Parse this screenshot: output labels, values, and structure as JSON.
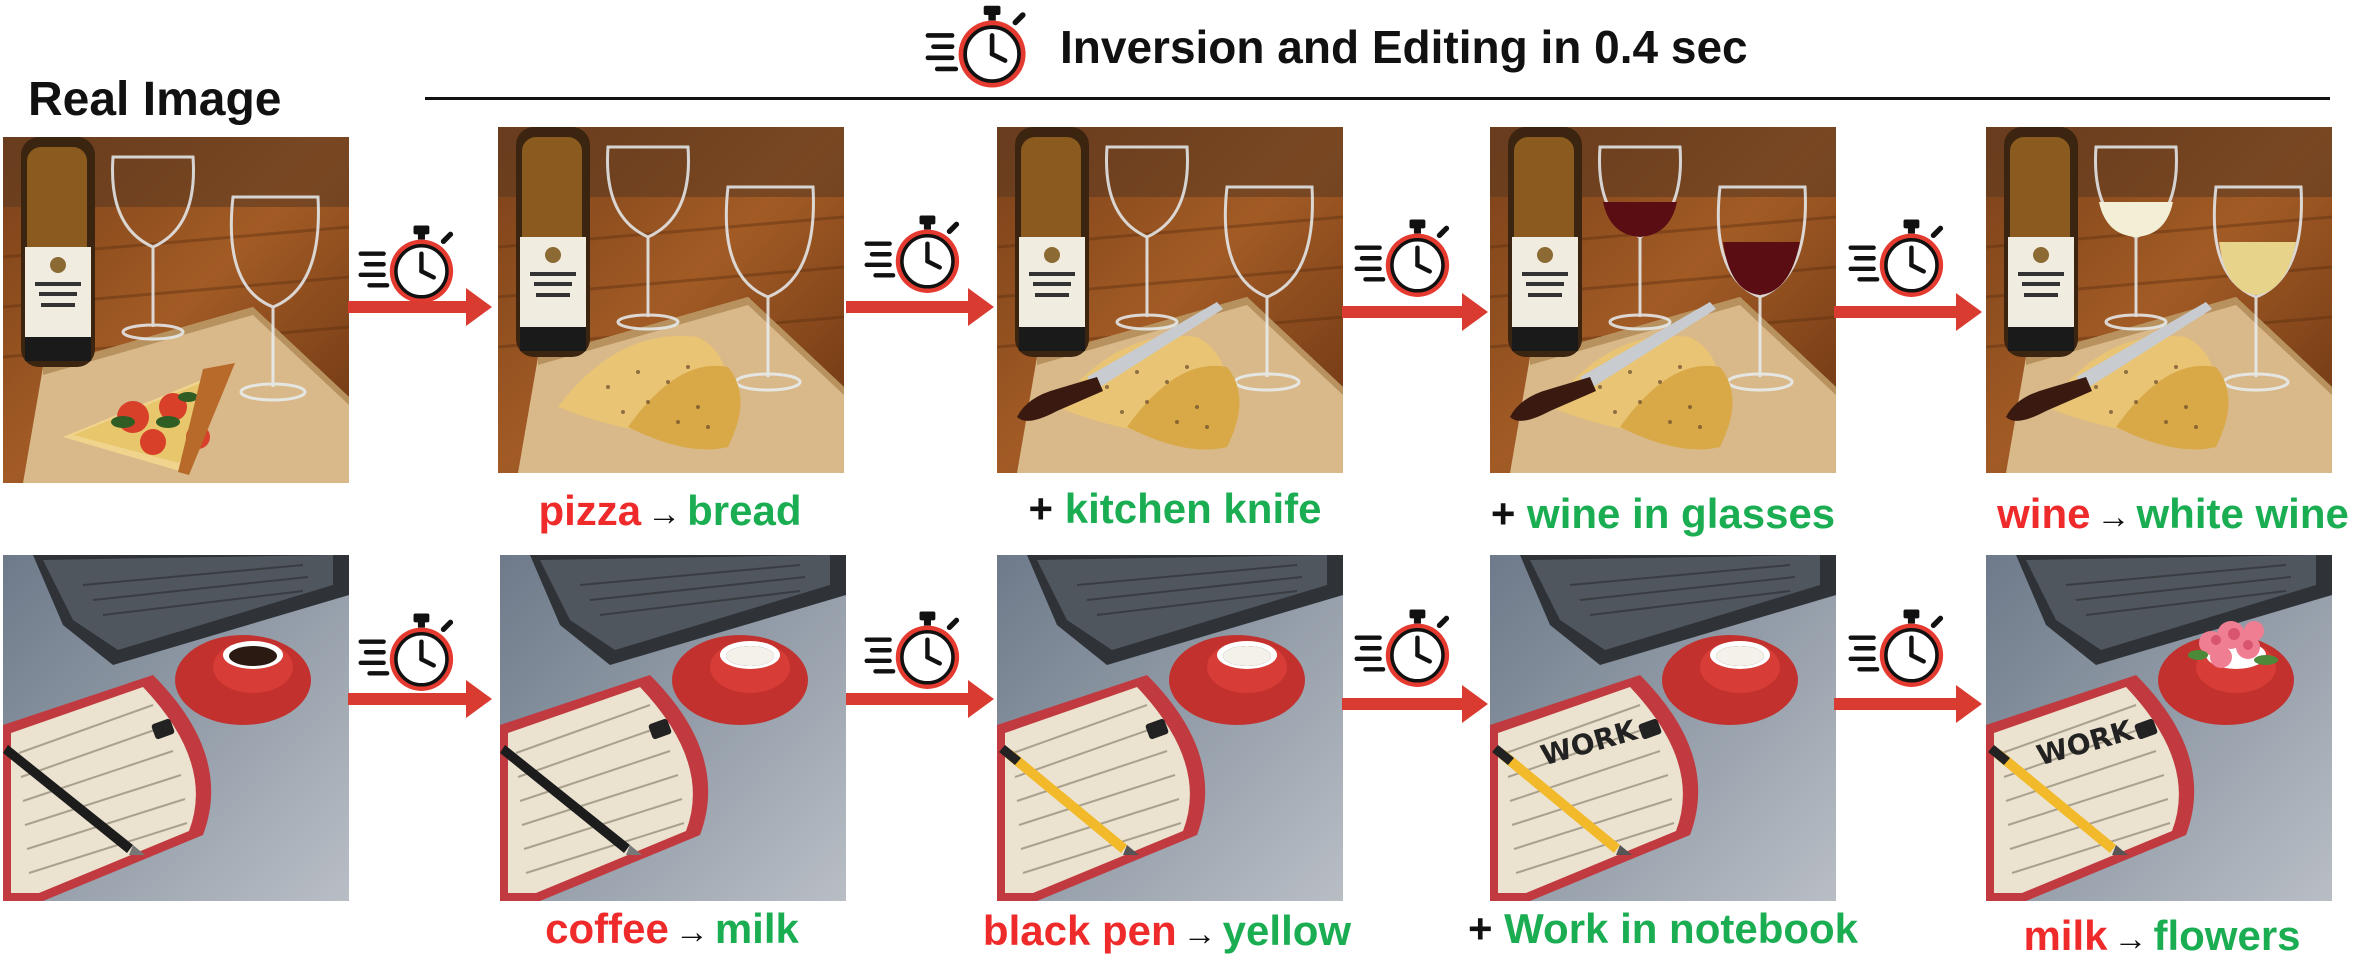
{
  "header": {
    "title": "Inversion and Editing in 0.4 sec"
  },
  "real_image_label": "Real Image",
  "icons": {
    "timer": "stopwatch-speed-icon",
    "arrow": "right-arrow-icon"
  },
  "colors": {
    "source_term": "#ee2a2a",
    "target_term": "#1aad52",
    "arrow": "#d93b30"
  },
  "rows": [
    {
      "scene": "wine-and-pizza",
      "captions": [
        {
          "src": "pizza",
          "sep": "→",
          "dst": "bread"
        },
        {
          "prefix": "+",
          "dst": "kitchen knife"
        },
        {
          "prefix": "+",
          "dst": "wine in glasses"
        },
        {
          "src": "wine",
          "sep": "→",
          "dst": "white wine"
        }
      ]
    },
    {
      "scene": "desk-with-notebook-and-cup",
      "captions": [
        {
          "src": "coffee",
          "sep": "→",
          "dst": "milk"
        },
        {
          "src": "black pen",
          "sep": "→",
          "dst": "yellow"
        },
        {
          "prefix": "+",
          "dst": "Work in notebook"
        },
        {
          "src": "milk",
          "sep": "→",
          "dst": "flowers"
        }
      ]
    }
  ],
  "notebook_text": "WORK"
}
